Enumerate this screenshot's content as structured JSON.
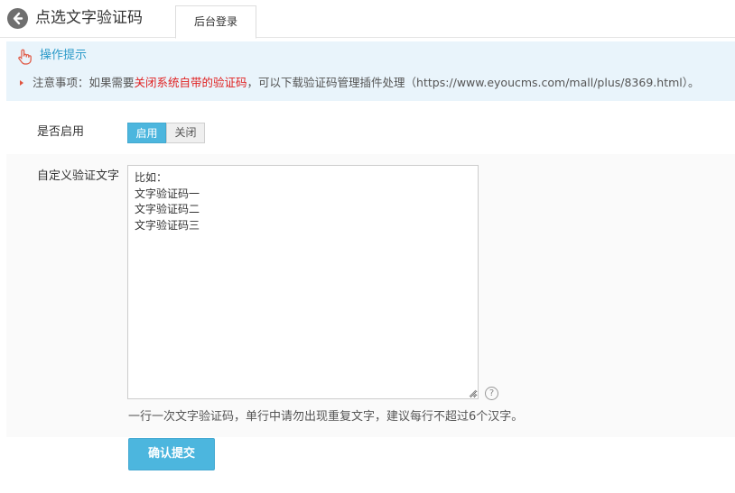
{
  "header": {
    "back_icon": "back-arrow-icon",
    "title": "点选文字验证码",
    "tab_label": "后台登录"
  },
  "tips": {
    "icon": "hand-pointer-icon",
    "title": "操作提示",
    "prefix": "注意事项：如果需要",
    "highlight": "关闭系统自带的验证码",
    "suffix": "，可以下载验证码管理插件处理（https://www.eyoucms.com/mall/plus/8369.html）。",
    "highlight_color": "#e02020"
  },
  "form": {
    "enable_label": "是否启用",
    "enable_on": "启用",
    "enable_off": "关闭",
    "enable_selected": "启用",
    "custom_label": "自定义验证文字",
    "textarea_value": "比如：\n文字验证码一\n文字验证码二\n文字验证码三",
    "help_icon": "question-circle-icon",
    "help_symbol": "?",
    "hint": "一行一次文字验证码，单行中请勿出现重复文字，建议每行不超过6个汉字。",
    "submit_label": "确认提交"
  },
  "colors": {
    "accent": "#4cb6de",
    "tips_bg": "#e9f4fb",
    "tips_title": "#2b9ac9"
  }
}
